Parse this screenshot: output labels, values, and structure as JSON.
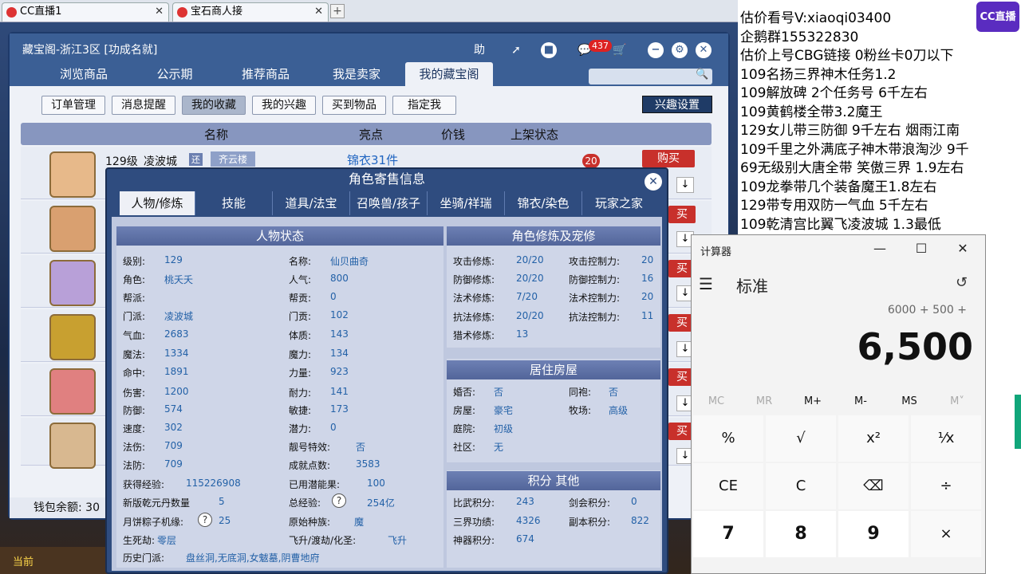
{
  "browser": {
    "tabs": [
      {
        "label": "CC直播1"
      },
      {
        "label": "宝石商人接"
      }
    ]
  },
  "cbg": {
    "title": "藏宝阁-浙江3区 [功成名就]",
    "header_btn_help": "助",
    "msg_count": "437",
    "nav": [
      "浏览商品",
      "公示期",
      "推荐商品",
      "我是卖家",
      "我的藏宝阁"
    ],
    "subnav": [
      "订单管理",
      "消息提醒",
      "我的收藏",
      "我的兴趣",
      "买到物品",
      "指定我"
    ],
    "interest_btn": "兴趣设置",
    "columns": [
      "名称",
      "亮点",
      "价钱",
      "上架状态"
    ],
    "first_row": {
      "level": "129级",
      "school": "凌波城",
      "tag": "还",
      "server": "齐云楼",
      "highlight": "锦衣31件",
      "badge": "20"
    },
    "buy_label": "购买",
    "buy_partial": "买",
    "wallet_label": "钱包余额: 30",
    "bottom_left": "当前"
  },
  "modal": {
    "title": "角色寄售信息",
    "tabs": [
      "人物/修炼",
      "技能",
      "道具/法宝",
      "召唤兽/孩子",
      "坐骑/祥瑞",
      "锦衣/染色",
      "玩家之家"
    ],
    "status_title": "人物状态",
    "left_col": [
      [
        "级别:",
        "129"
      ],
      [
        "角色:",
        "桃夭夭"
      ],
      [
        "帮派:",
        ""
      ],
      [
        "门派:",
        "凌波城"
      ],
      [
        "气血:",
        "2683"
      ],
      [
        "魔法:",
        "1334"
      ],
      [
        "命中:",
        "1891"
      ],
      [
        "伤害:",
        "1200"
      ],
      [
        "防御:",
        "574"
      ],
      [
        "速度:",
        "302"
      ],
      [
        "法伤:",
        "709"
      ],
      [
        "法防:",
        "709"
      ]
    ],
    "right_col": [
      [
        "名称:",
        "仙贝曲奇"
      ],
      [
        "人气:",
        "800"
      ],
      [
        "帮贡:",
        "0"
      ],
      [
        "门贡:",
        "102"
      ],
      [
        "体质:",
        "143"
      ],
      [
        "魔力:",
        "134"
      ],
      [
        "力量:",
        "923"
      ],
      [
        "耐力:",
        "141"
      ],
      [
        "敏捷:",
        "173"
      ],
      [
        "潜力:",
        "0"
      ],
      [
        "靓号特效:",
        "否"
      ],
      [
        "成就点数:",
        "3583"
      ]
    ],
    "exp_label": "获得经验:",
    "exp_value": "115226908",
    "used_pot_label": "已用潜能果:",
    "used_pot_value": "100",
    "qianyuan_label": "新版乾元丹数量",
    "qianyuan_value": "5",
    "total_exp_label": "总经验:",
    "total_exp_value": "254亿",
    "mooncake_label": "月饼粽子机缘:",
    "mooncake_value": "25",
    "race_label": "原始种族:",
    "race_value": "魔",
    "life_label": "生死劫:",
    "life_value": "零层",
    "fly_label": "飞升/渡劫/化圣:",
    "fly_value": "飞升",
    "history_label": "历史门派:",
    "history_value": "盘丝洞,无底洞,女魃墓,阴曹地府",
    "cult_title": "角色修炼及宠修",
    "cult_left": [
      [
        "攻击修炼:",
        "20/20"
      ],
      [
        "防御修炼:",
        "20/20"
      ],
      [
        "法术修炼:",
        "7/20"
      ],
      [
        "抗法修炼:",
        "20/20"
      ],
      [
        "猎术修炼:",
        "13"
      ]
    ],
    "cult_right": [
      [
        "攻击控制力:",
        "20"
      ],
      [
        "防御控制力:",
        "16"
      ],
      [
        "法术控制力:",
        "20"
      ],
      [
        "抗法控制力:",
        "11"
      ]
    ],
    "house_title": "居住房屋",
    "house_left": [
      [
        "婚否:",
        "否"
      ],
      [
        "房屋:",
        "豪宅"
      ],
      [
        "庭院:",
        "初级"
      ],
      [
        "社区:",
        "无"
      ]
    ],
    "house_right": [
      [
        "同袍:",
        "否"
      ],
      [
        "牧场:",
        "高级"
      ]
    ],
    "score_title": "积分 其他",
    "score_left": [
      [
        "比武积分:",
        "243"
      ],
      [
        "三界功绩:",
        "4326"
      ],
      [
        "神器积分:",
        "674"
      ]
    ],
    "score_right": [
      [
        "剑会积分:",
        "0"
      ],
      [
        "副本积分:",
        "822"
      ]
    ],
    "question_mark": "?"
  },
  "stream": {
    "lines": [
      "估价看号V:xiaoqi03400",
      "企鹅群155322830",
      "估价上号CBG链接 0粉丝卡0刀以下",
      "109名扬三界神木任务1.2",
      "109解放碑 2个任务号 6千左右",
      "109黄鹤楼全带3.2魔王",
      "129女儿带三防御 9千左右 烟雨江南",
      "109千里之外满底子神木带浪淘沙 9千",
      "69无级别大唐全带 笑傲三界 1.9左右",
      "109龙拳带几个装备魔王1.8左右",
      "129带专用双防一气血 5千左右",
      "109乾清宫比翼飞凌波城 1.3最低"
    ],
    "logo": "CC直播"
  },
  "calculator": {
    "title": "计算器",
    "mode": "标准",
    "expression": "6000 + 500 +",
    "display": "6,500",
    "memory": [
      "MC",
      "MR",
      "M+",
      "M-",
      "MS",
      "M˅"
    ],
    "keys": [
      "%",
      "√",
      "x²",
      "¹⁄x",
      "CE",
      "C",
      "⌫",
      "÷",
      "7",
      "8",
      "9",
      "×"
    ]
  }
}
